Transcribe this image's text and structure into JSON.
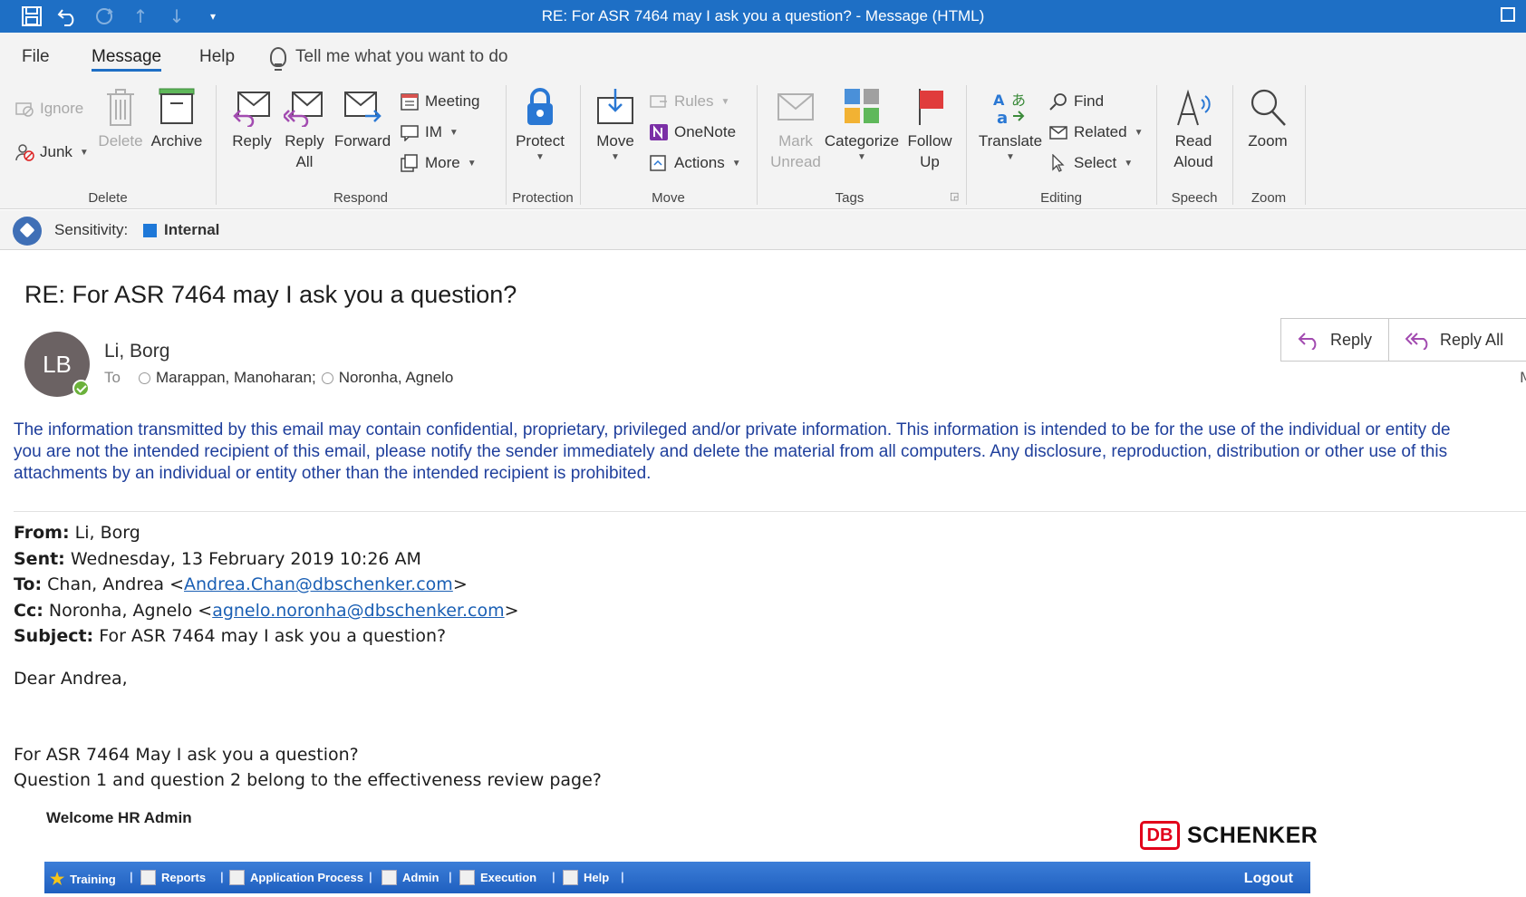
{
  "window": {
    "title": "RE: For ASR 7464 may I ask you a question?  -  Message (HTML)"
  },
  "quick_access": {
    "icons": [
      "save-icon",
      "undo-icon",
      "redo-icon",
      "up-arrow-icon",
      "down-arrow-icon",
      "customize-icon"
    ]
  },
  "tabs": {
    "file": "File",
    "message": "Message",
    "help": "Help",
    "tell_me": "Tell me what you want to do",
    "active": "Message"
  },
  "ribbon": {
    "delete_group": {
      "label": "Delete",
      "ignore": "Ignore",
      "junk": "Junk",
      "delete": "Delete",
      "archive": "Archive"
    },
    "respond_group": {
      "label": "Respond",
      "reply": "Reply",
      "reply_all_1": "Reply",
      "reply_all_2": "All",
      "forward": "Forward",
      "meeting": "Meeting",
      "im": "IM",
      "more": "More"
    },
    "protection_group": {
      "label": "Protection",
      "protect": "Protect"
    },
    "move_group": {
      "label": "Move",
      "move": "Move",
      "rules": "Rules",
      "onenote": "OneNote",
      "actions": "Actions"
    },
    "tags_group": {
      "label": "Tags",
      "mark_unread_1": "Mark",
      "mark_unread_2": "Unread",
      "categorize": "Categorize",
      "follow_up_1": "Follow",
      "follow_up_2": "Up"
    },
    "editing_group": {
      "label": "Editing",
      "translate": "Translate",
      "find": "Find",
      "related": "Related",
      "select": "Select"
    },
    "speech_group": {
      "label": "Speech",
      "read_aloud_1": "Read",
      "read_aloud_2": "Aloud"
    },
    "zoom_group": {
      "label": "Zoom",
      "zoom": "Zoom"
    }
  },
  "sensitivity": {
    "label": "Sensitivity:",
    "value": "Internal",
    "color": "#1e78d8"
  },
  "message": {
    "subject": "RE: For ASR 7464 may I ask you a question?",
    "avatar_initials": "LB",
    "sender": "Li, Borg",
    "to_label": "To",
    "recipients": [
      "Marappan, Manoharan;",
      "Noronha, Agnelo"
    ],
    "reply": "Reply",
    "reply_all": "Reply All",
    "edge_glyph": "M"
  },
  "body": {
    "disclaimer": [
      "The information transmitted by this email may contain confidential, proprietary, privileged and/or private information. This information is intended to be for the use of the individual or entity de",
      "you are not the intended recipient of this email, please notify the sender immediately and delete the material from all computers. Any disclosure, reproduction, distribution or other use of this",
      "attachments by an individual or entity other than the intended recipient is prohibited."
    ],
    "from_label": "From:",
    "from_value": "Li, Borg",
    "sent_label": "Sent:",
    "sent_value": "Wednesday, 13 February 2019 10:26 AM",
    "to_label": "To:",
    "to_name": "Chan, Andrea <",
    "to_email": "Andrea.Chan@dbschenker.com",
    "to_close": ">",
    "cc_label": "Cc:",
    "cc_name": "Noronha, Agnelo <",
    "cc_email": "agnelo.noronha@dbschenker.com",
    "cc_close": ">",
    "subject_label": "Subject:",
    "subject_value": "For ASR 7464 may I ask you a question?",
    "greeting": "Dear Andrea,",
    "line1": "For ASR 7464 May I ask you a question?",
    "line2": "Question 1 and question 2 belong to the effectiveness review page?"
  },
  "embedded": {
    "welcome": "Welcome HR Admin",
    "logo_db": "DB",
    "logo_text": "SCHENKER",
    "nav": [
      "Training",
      "Reports",
      "Application Process",
      "Admin",
      "Execution",
      "Help"
    ],
    "logout": "Logout"
  }
}
